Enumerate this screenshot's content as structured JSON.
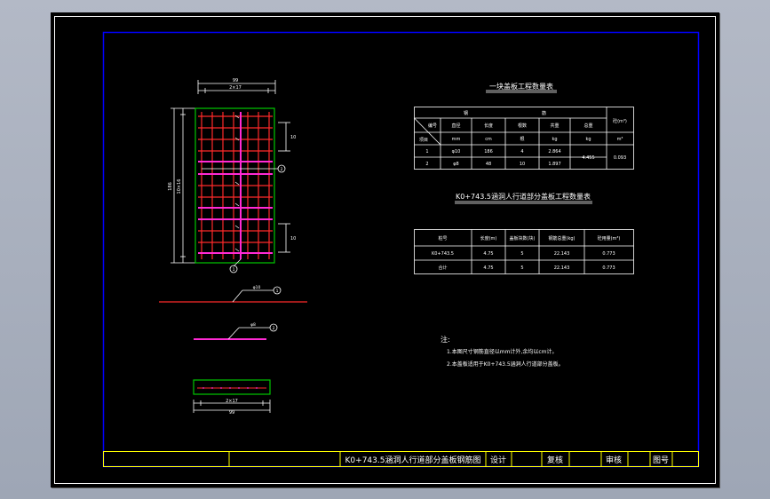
{
  "drawing": {
    "title_block": {
      "title": "K0+743.5涵洞人行道部分盖板钢筋图",
      "design": "设计",
      "check": "复核",
      "review": "审核",
      "drawing_no": "图号"
    },
    "table1": {
      "title": "一块盖板工程数量表",
      "group_header_left": "钢",
      "group_header_right": "筋",
      "header_last": "砼(m³)",
      "diag_top": "编号",
      "diag_bottom": "项目",
      "columns": [
        "直径",
        "长度",
        "根数",
        "共重",
        "总重"
      ],
      "unit_row": [
        "mm",
        "cm",
        "根",
        "kg",
        "kg",
        "m³"
      ],
      "rows": [
        {
          "no": "1",
          "dia": "φ10",
          "len": "186",
          "count": "4",
          "wt": "2.864"
        },
        {
          "no": "2",
          "dia": "φ8",
          "len": "48",
          "count": "10",
          "wt": "1.897"
        }
      ],
      "total_weight": "4.455",
      "concrete": "0.093"
    },
    "table2": {
      "title": "K0+743.5涵洞人行道部分盖板工程数量表",
      "columns": [
        "桩号",
        "长度(m)",
        "盖板块数(块)",
        "钢筋总重(kg)",
        "砼用量(m³)"
      ],
      "rows": [
        [
          "K0+743.5",
          "4.75",
          "5",
          "22.143",
          "0.773"
        ],
        [
          "合计",
          "4.75",
          "5",
          "22.143",
          "0.773"
        ]
      ]
    },
    "notes": {
      "heading": "注:",
      "items": [
        "1.本图尺寸钢筋直径以mm计外,余均以cm计。",
        "2.本盖板适用于K0+743.5涵洞人行道部分盖板。"
      ]
    },
    "plan": {
      "top_dim_total": "99",
      "top_dim_sub": "2×17",
      "left_dim_total": "186",
      "left_dim_sub": "10×16",
      "right_dim_top": "10",
      "right_dim_bottom": "10",
      "bar1_mark": "1",
      "bar2_mark": "2",
      "bar1_label": "φ10",
      "bar2_label": "φ8",
      "sec_dim_sub": "2×17",
      "sec_dim_total": "99"
    },
    "colors": {
      "bar1": "#ff2a2a",
      "bar2": "#ff2ad4",
      "outline": "#00c800",
      "frame": "#0000ff",
      "text": "#ffffff",
      "title_text": "#ffff00"
    }
  }
}
